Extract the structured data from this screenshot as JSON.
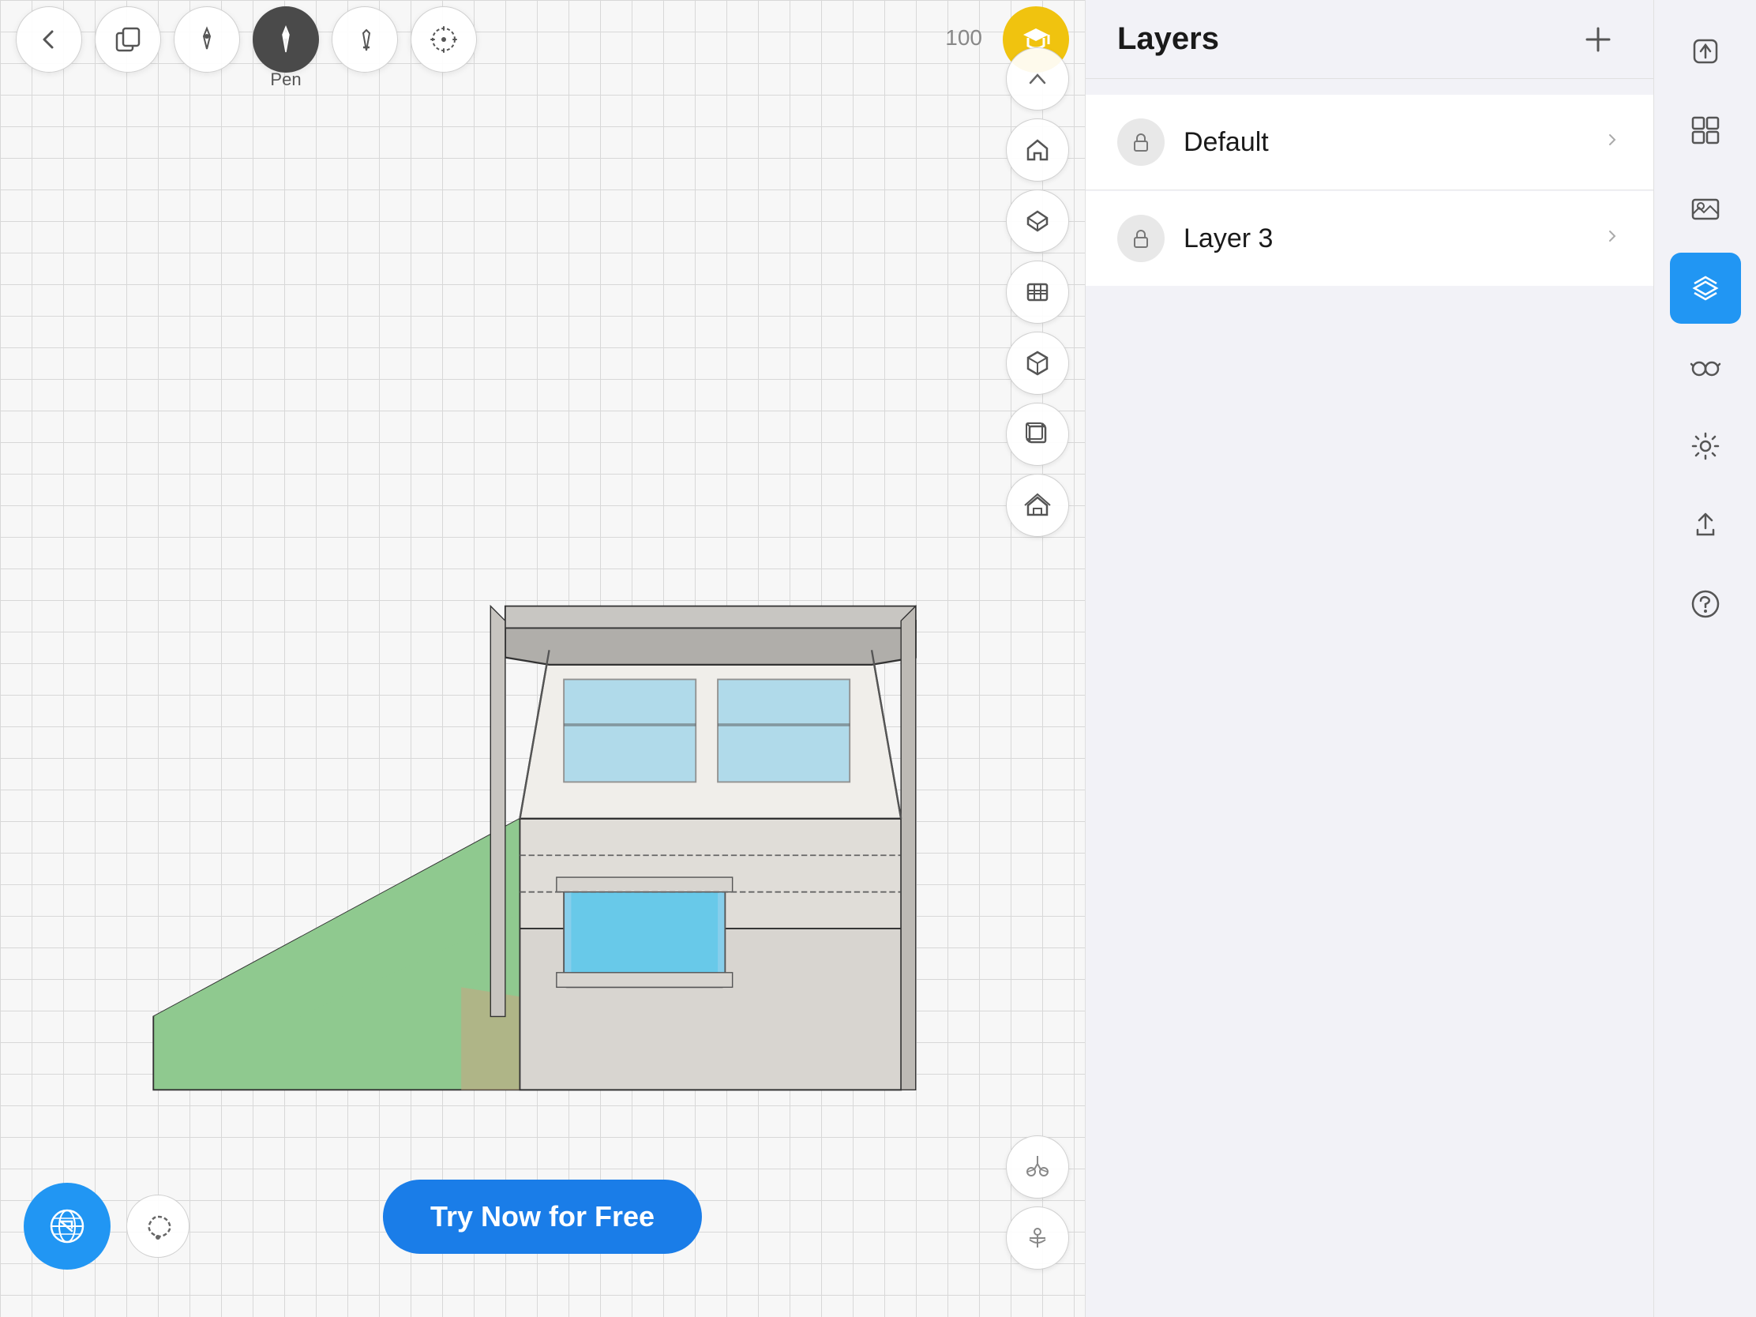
{
  "toolbar": {
    "back_label": "←",
    "copy_label": "⧉",
    "pen_label": "Pen",
    "pen_active": true,
    "opacity_value": "100",
    "graduation_icon": "🎓"
  },
  "right_toolbar": {
    "chevron_up": "︿",
    "home_icon": "⌂",
    "home2_icon": "⌂",
    "briefcase_icon": "💼",
    "archive_icon": "🗃",
    "cube_icon": "⬡",
    "cube2_icon": "⬡",
    "house3d_icon": "⌂",
    "transform_icon": "⊕"
  },
  "bottom_tools": {
    "scissors_icon": "✂",
    "anchor_icon": "⚓"
  },
  "try_now": {
    "label": "Try Now for Free"
  },
  "bottom_left": {
    "globe_icon": "🌐",
    "lasso_icon": "◌"
  },
  "layers_panel": {
    "title": "Layers",
    "add_icon": "+",
    "layers": [
      {
        "name": "Default",
        "locked": true
      },
      {
        "name": "Layer 3",
        "locked": true
      }
    ]
  },
  "far_right": {
    "export_icon": "↗",
    "grid_icon": "⊞",
    "image_icon": "🖼",
    "layers_icon": "≡",
    "glasses_icon": "👓",
    "settings_icon": "⚙",
    "upload_icon": "⬆",
    "help_icon": "?"
  }
}
